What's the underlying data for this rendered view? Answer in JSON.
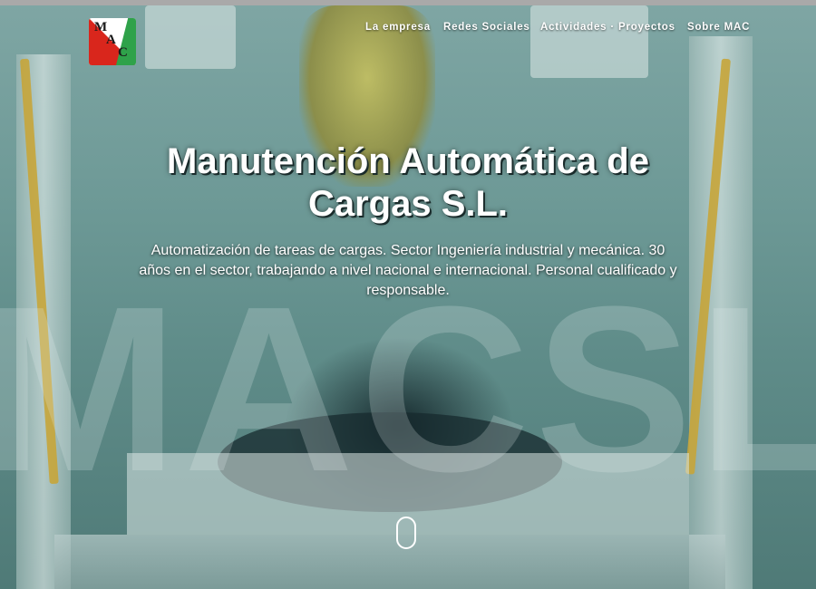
{
  "logo": {
    "letters": [
      "M",
      "A",
      "C"
    ]
  },
  "nav": {
    "items": [
      {
        "label": "La empresa"
      },
      {
        "label": "Redes Sociales"
      },
      {
        "label": "Actividades · Proyectos"
      },
      {
        "label": "Sobre MAC"
      }
    ]
  },
  "hero": {
    "title": "Manutención Automática de Cargas S.L.",
    "subtitle": "Automatización de tareas de cargas. Sector Ingeniería industrial y mecánica. 30 años en el sector, trabajando a nivel nacional e internacional. Personal cualificado y responsable.",
    "watermark": "MACSL"
  },
  "colors": {
    "accent": "#d9261c",
    "logo_green": "#2fa24a",
    "text": "#ffffff"
  }
}
